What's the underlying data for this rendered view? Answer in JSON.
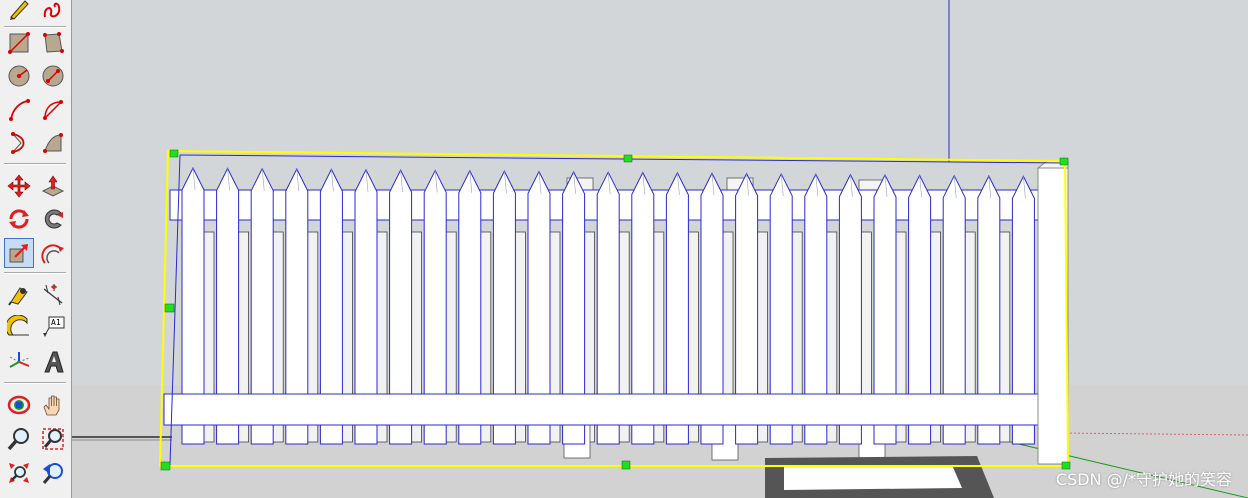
{
  "toolbar": {
    "tools": [
      {
        "id": "pencil",
        "icon": "pencil-icon"
      },
      {
        "id": "freehand",
        "icon": "freehand-icon"
      },
      {
        "id": "rectangle",
        "icon": "rectangle-icon"
      },
      {
        "id": "rotated-rectangle",
        "icon": "rotated-rectangle-icon"
      },
      {
        "id": "circle",
        "icon": "circle-icon"
      },
      {
        "id": "polygon",
        "icon": "polygon-icon"
      },
      {
        "id": "arc",
        "icon": "arc-icon"
      },
      {
        "id": "pie",
        "icon": "pie-icon"
      },
      {
        "id": "two-point-arc",
        "icon": "two-point-arc-icon"
      },
      {
        "id": "three-point-arc",
        "icon": "three-point-arc-icon"
      },
      {
        "id": "move",
        "icon": "move-icon"
      },
      {
        "id": "push-pull",
        "icon": "push-pull-icon"
      },
      {
        "id": "rotate",
        "icon": "rotate-icon"
      },
      {
        "id": "follow-me",
        "icon": "follow-me-icon"
      },
      {
        "id": "scale",
        "icon": "scale-icon",
        "active": true
      },
      {
        "id": "offset",
        "icon": "offset-icon"
      },
      {
        "id": "tape-measure",
        "icon": "tape-measure-icon"
      },
      {
        "id": "dimension",
        "icon": "dimension-icon"
      },
      {
        "id": "protractor",
        "icon": "protractor-icon"
      },
      {
        "id": "text",
        "icon": "text-icon",
        "label": "A1"
      },
      {
        "id": "axes",
        "icon": "axes-icon"
      },
      {
        "id": "3d-text",
        "icon": "3d-text-icon"
      },
      {
        "id": "orbit",
        "icon": "orbit-icon"
      },
      {
        "id": "pan",
        "icon": "pan-icon"
      },
      {
        "id": "zoom",
        "icon": "zoom-icon"
      },
      {
        "id": "zoom-window",
        "icon": "zoom-window-icon"
      },
      {
        "id": "zoom-extents",
        "icon": "zoom-extents-icon"
      },
      {
        "id": "previous-view",
        "icon": "previous-view-icon"
      }
    ]
  },
  "viewport": {
    "sky_color": "#d3d6d9",
    "ground_color": "#d2d2d2",
    "selection_color": "#ffff00",
    "edge_color": "#0000cc",
    "grip_color": "#22dd22",
    "fence_color": "#ffffff",
    "picket_count": 25
  },
  "watermark": {
    "text": "CSDN @/*守护她的笑容"
  }
}
